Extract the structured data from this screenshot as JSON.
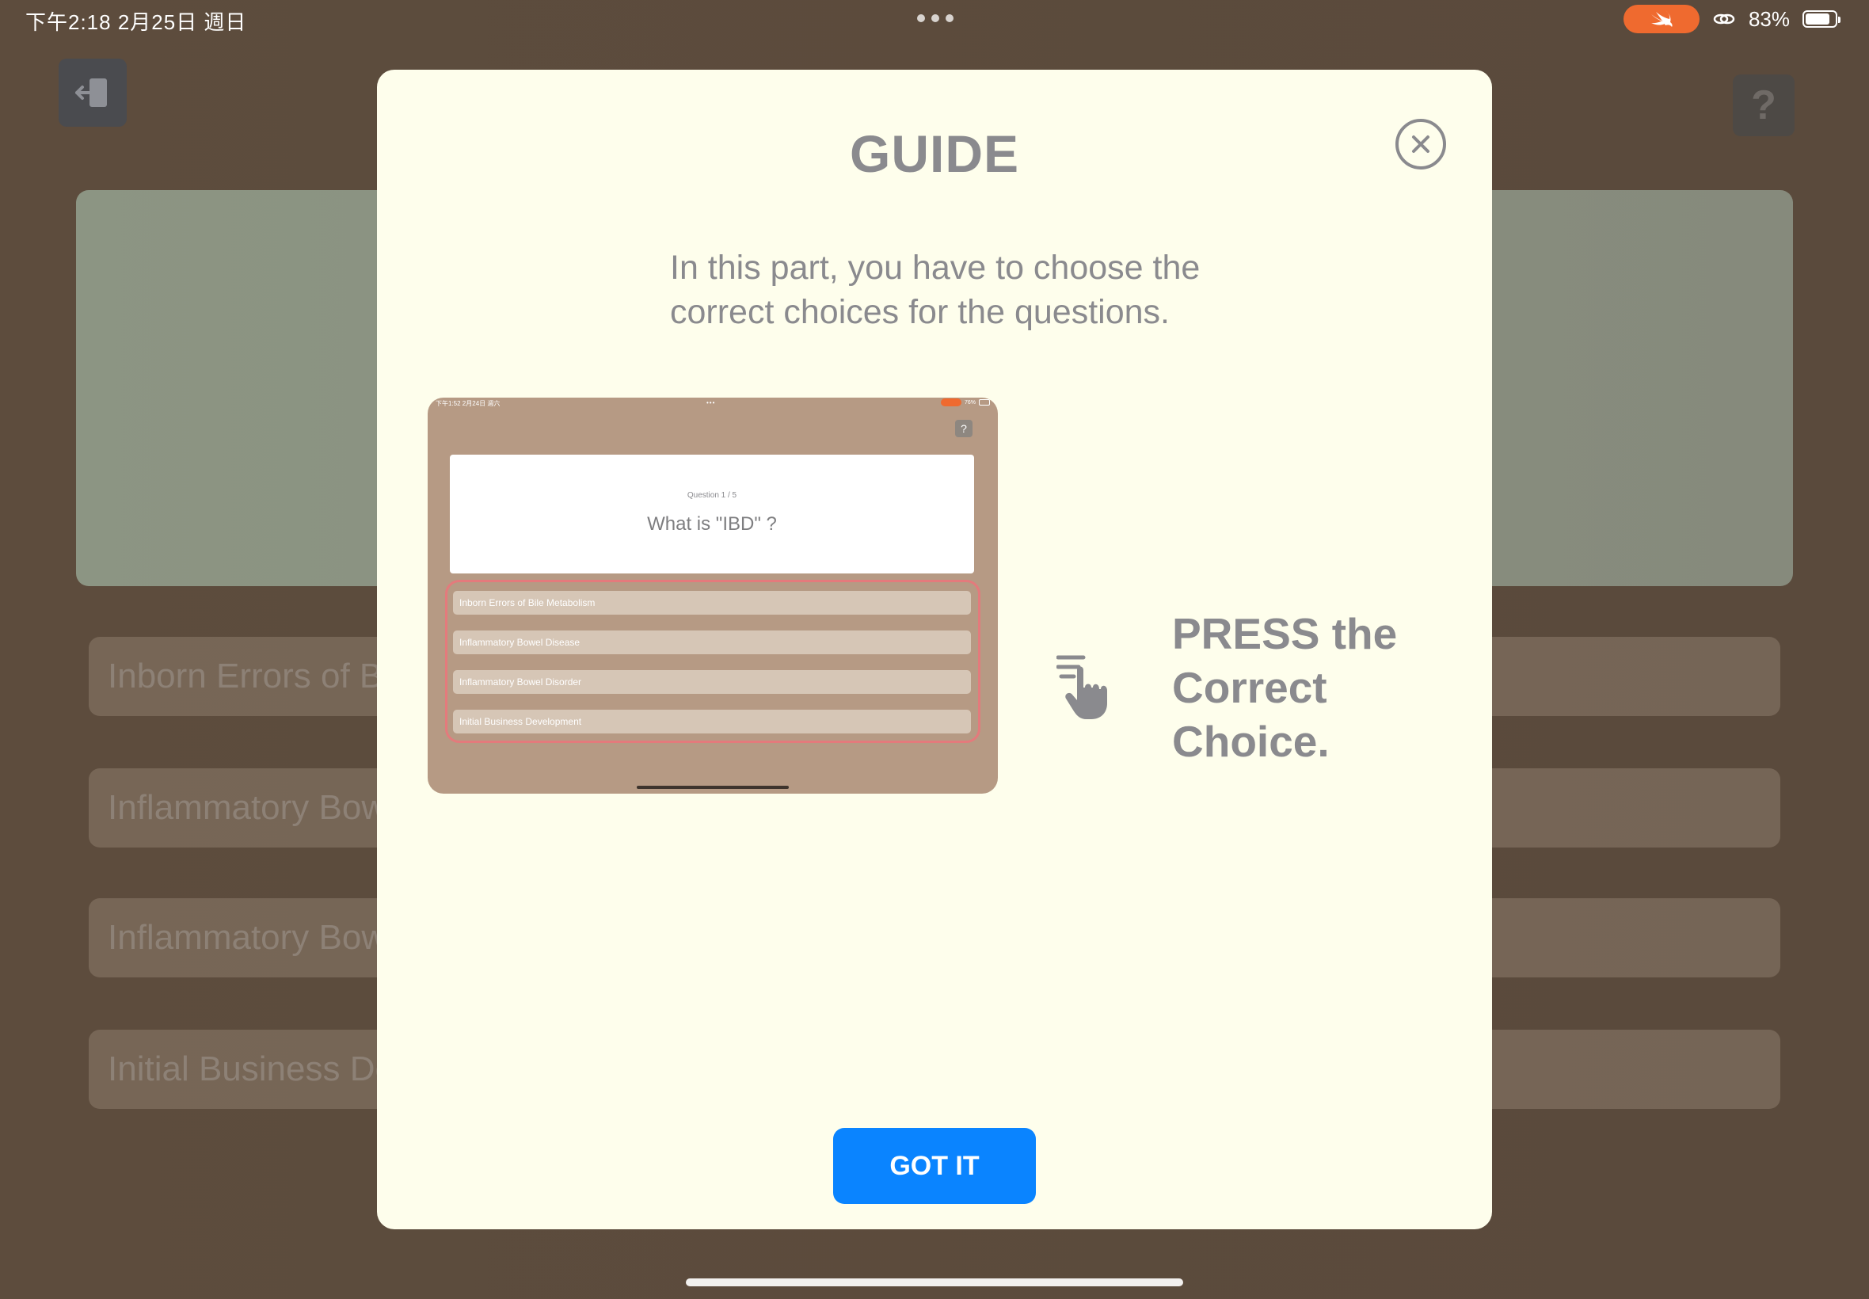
{
  "status_bar": {
    "time_date": "下午2:18   2月25日 週日",
    "battery": "83%",
    "battery_level": 0.83
  },
  "background": {
    "help_label": "?",
    "choices": [
      "Inborn Errors of Bile Metabolism",
      "Inflammatory Bowel Disease",
      "Inflammatory Bowel Disorder",
      "Initial Business Development"
    ]
  },
  "guide": {
    "title": "GUIDE",
    "description": "In this part, you have to choose the correct choices for the questions.",
    "instruction": "PRESS the Correct Choice.",
    "button_label": "GOT IT",
    "preview": {
      "status_time": "下午1:52  2月24日 週六",
      "status_dots": "•••",
      "status_battery": "76%",
      "help_label": "?",
      "question_number": "Question 1 / 5",
      "question_text": "What is \"IBD\" ?",
      "choices": [
        "Inborn Errors of Bile Metabolism",
        "Inflammatory Bowel Disease",
        "Inflammatory Bowel Disorder",
        "Initial Business Development"
      ]
    }
  },
  "colors": {
    "accent": "#0a84ff",
    "swift_orange": "#ef6a2f",
    "highlight": "#e47a7c",
    "modal_bg": "#fefeec"
  }
}
